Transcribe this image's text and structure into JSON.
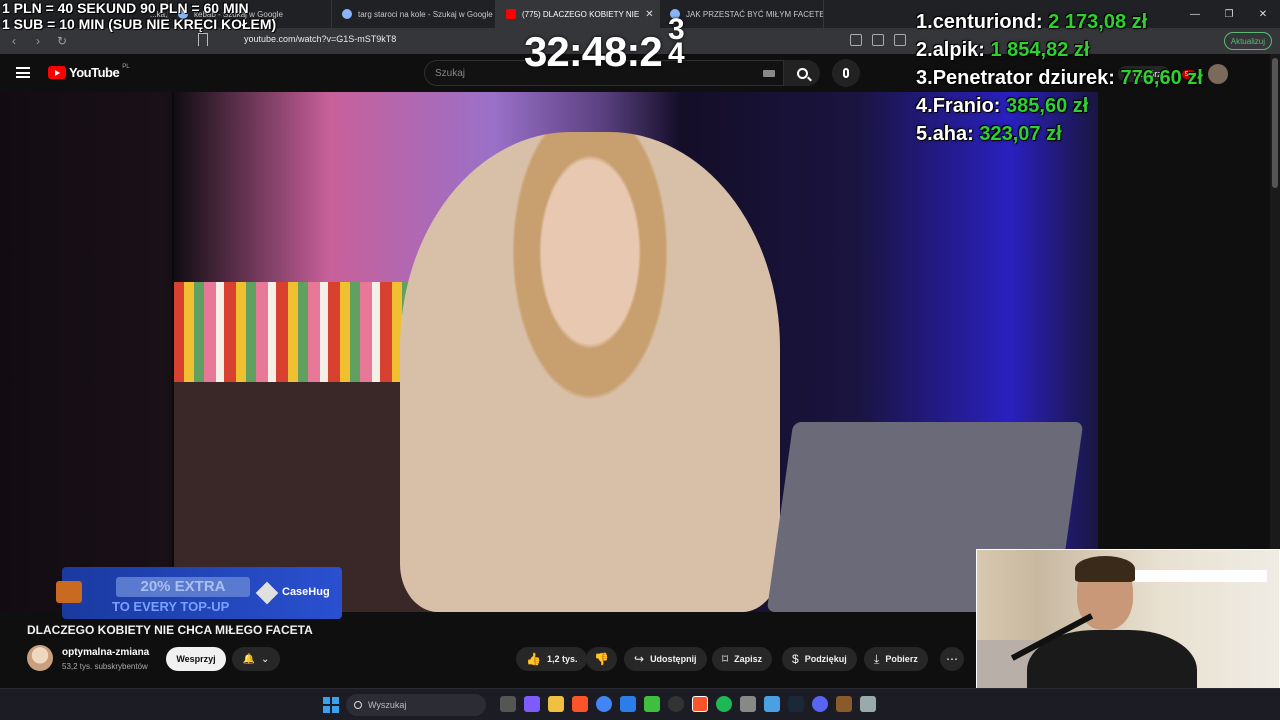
{
  "overlay": {
    "rules_line1": "1 PLN = 40 SEKUND 90 PLN = 60 MIN",
    "rules_line2": "1 SUB = 10 MIN (SUB NIE KRĘCI KOŁEM)",
    "timer": "32:48:2",
    "timer_fraction_top": "3",
    "timer_fraction_bottom": "4",
    "leaderboard": [
      {
        "rank": "1.",
        "name": "centuriond:",
        "amount": "2 173,08 zł"
      },
      {
        "rank": "2.",
        "name": "alpik:",
        "amount": "1 854,82 zł"
      },
      {
        "rank": "3.",
        "name": "Penetrator dziurek:",
        "amount": "776,60 zł"
      },
      {
        "rank": "4.",
        "name": "Franio:",
        "amount": "385,60 zł"
      },
      {
        "rank": "5.",
        "name": "aha:",
        "amount": "323,07 zł"
      }
    ]
  },
  "browser": {
    "tabs": [
      {
        "title": "...ka, Warszaw"
      },
      {
        "title": "kebab - Szukaj w Google"
      },
      {
        "title": "targ staroci na kole - Szukaj w Google"
      },
      {
        "title": "(775) DLACZEGO KOBIETY NIE"
      },
      {
        "title": "JAK PRZESTAĆ BYĆ MIŁYM FACETEM"
      }
    ],
    "url": "youtube.com/watch?v=G1S-mST9kT8",
    "update_label": "Aktualizuj"
  },
  "youtube": {
    "logo_text": "YouTube",
    "logo_country": "PL",
    "search_placeholder": "Szukaj",
    "create_label": "+ Utwórz",
    "notif_badge": "9+"
  },
  "ad": {
    "line1": "20% EXTRA",
    "line2": "TO EVERY TOP-UP",
    "brand": "CaseHug"
  },
  "video": {
    "title": "DLACZEGO KOBIETY NIE CHCA MIŁEGO FACETA",
    "channel_name": "optymalna-zmiana",
    "channel_subs": "53,2 tys. subskrybentów",
    "support_label": "Wesprzyj",
    "likes": "1,2 tys.",
    "share_label": "Udostępnij",
    "save_label": "Zapisz",
    "thanks_label": "Podziękuj",
    "download_label": "Pobierz"
  },
  "taskbar": {
    "search_placeholder": "Wyszukaj"
  },
  "colors": {
    "donation_green": "#2fd12f",
    "yt_red": "#ff0000",
    "update_green": "#5bb974"
  }
}
